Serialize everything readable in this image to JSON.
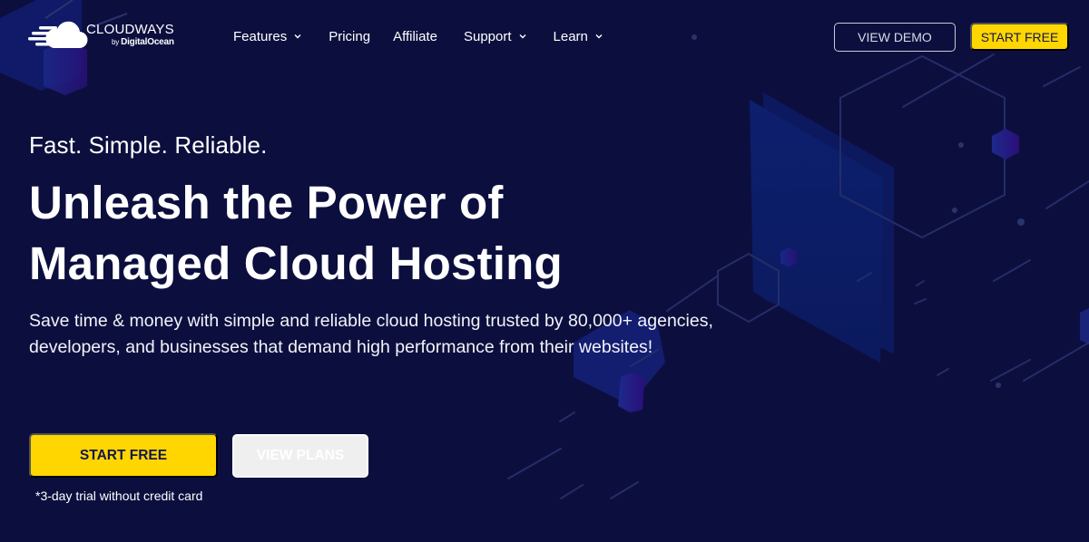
{
  "brand": {
    "name": "CLOUDWAYS",
    "sub_by": "by",
    "sub_name": "DigitalOcean",
    "logo_icon": "cloud-speed-icon"
  },
  "nav": {
    "items": [
      {
        "label": "Features",
        "has_dropdown": true
      },
      {
        "label": "Pricing",
        "has_dropdown": false
      },
      {
        "label": "Affiliate",
        "has_dropdown": false
      },
      {
        "label": "Support",
        "has_dropdown": true
      },
      {
        "label": "Learn",
        "has_dropdown": true
      }
    ],
    "view_demo_label": "VIEW DEMO",
    "start_free_label": "START FREE"
  },
  "hero": {
    "tagline": "Fast. Simple. Reliable.",
    "headline_line1": "Unleash the Power of",
    "headline_line2": "Managed Cloud Hosting",
    "description": "Save time & money with simple and reliable cloud hosting trusted by 80,000+ agencies, developers, and businesses that demand high performance from their websites!",
    "start_free_label": "START FREE",
    "view_plans_label": "VIEW PLANS",
    "trial_note": "*3-day trial without credit card"
  },
  "colors": {
    "background": "#0c0f3e",
    "accent_yellow": "#ffd600",
    "button_text_dark": "#14164b",
    "decor_blue": "#0d1c66",
    "decor_line": "#2a336e"
  }
}
